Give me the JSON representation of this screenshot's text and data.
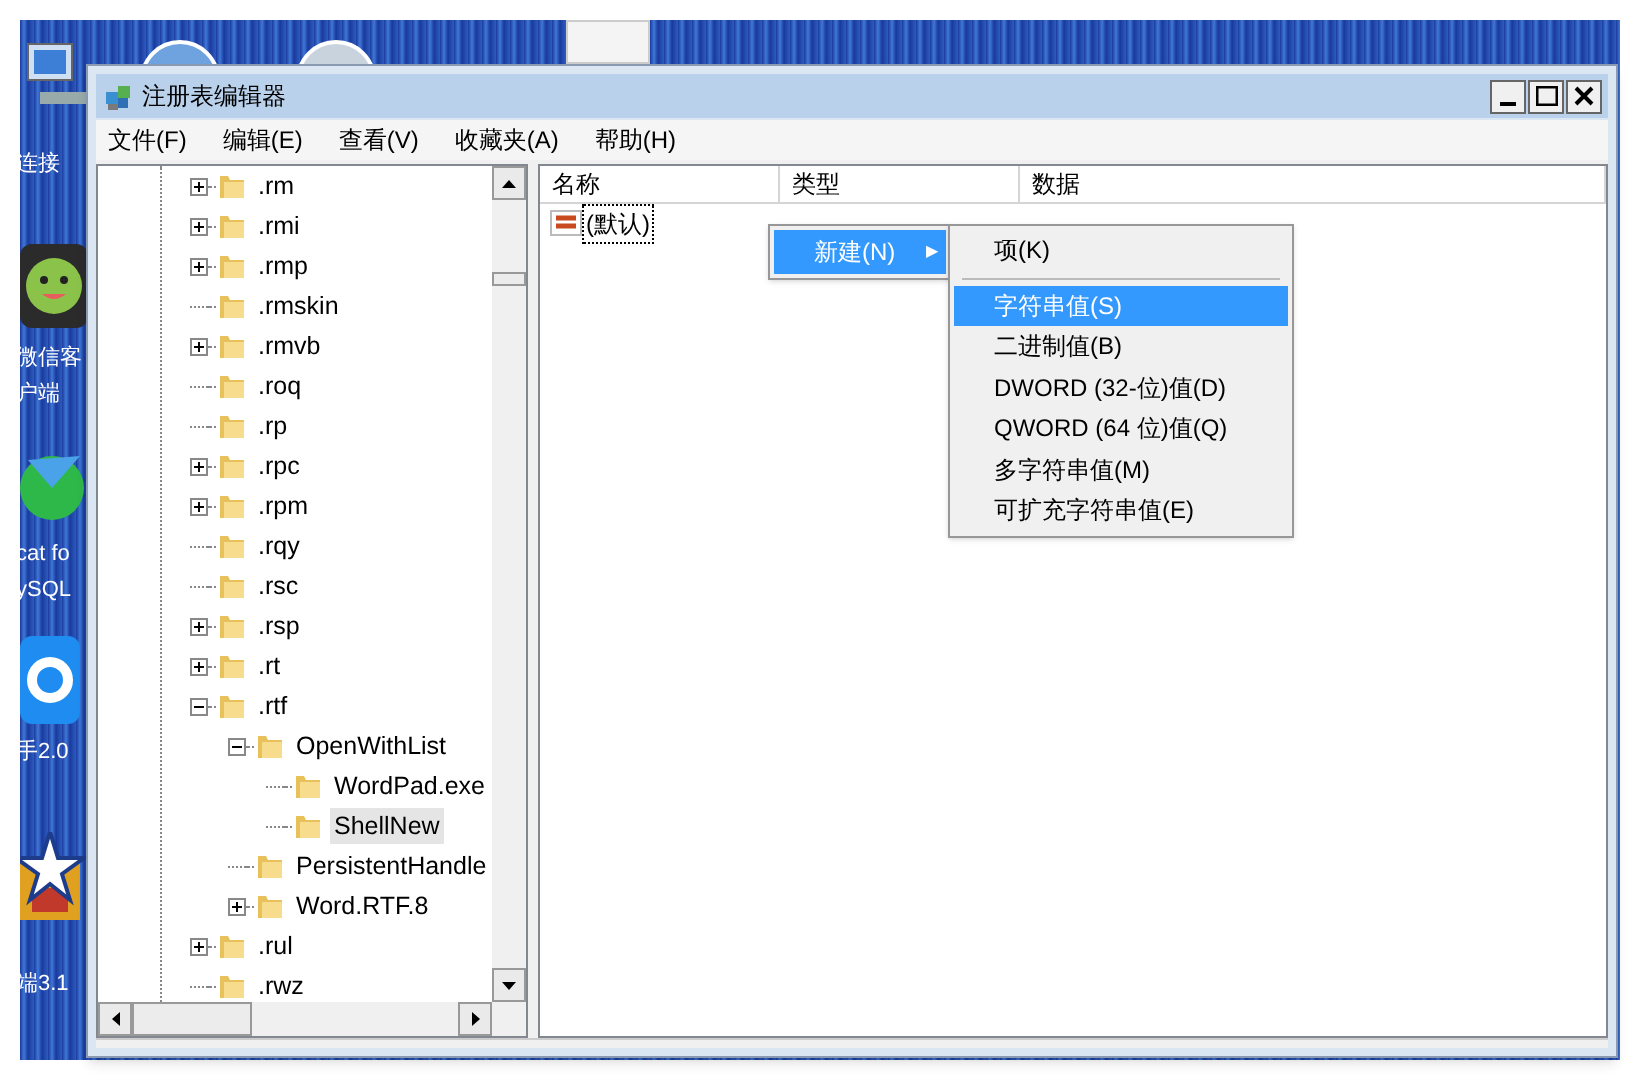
{
  "desktop": {
    "icon_labels": [
      {
        "text": "连接",
        "kind": "network"
      },
      {
        "text": "微信客",
        "kind": "face"
      },
      {
        "text": "户端",
        "kind": "none"
      },
      {
        "text": "cat fo",
        "kind": "ball"
      },
      {
        "text": "ySQL",
        "kind": "none"
      },
      {
        "text": "手2.0",
        "kind": "ring"
      },
      {
        "text": "端3.1",
        "kind": "star"
      }
    ]
  },
  "window": {
    "title": "注册表编辑器"
  },
  "menu_bar": [
    "文件(F)",
    "编辑(E)",
    "查看(V)",
    "收藏夹(A)",
    "帮助(H)"
  ],
  "tree": [
    {
      "name": ".rm",
      "kind": "collapsed",
      "selected": false
    },
    {
      "name": ".rmi",
      "kind": "collapsed",
      "selected": false
    },
    {
      "name": ".rmp",
      "kind": "collapsed",
      "selected": false
    },
    {
      "name": ".rmskin",
      "kind": "leaf",
      "selected": false
    },
    {
      "name": ".rmvb",
      "kind": "collapsed",
      "selected": false
    },
    {
      "name": ".roq",
      "kind": "leaf",
      "selected": false
    },
    {
      "name": ".rp",
      "kind": "leaf",
      "selected": false
    },
    {
      "name": ".rpc",
      "kind": "collapsed",
      "selected": false
    },
    {
      "name": ".rpm",
      "kind": "collapsed",
      "selected": false
    },
    {
      "name": ".rqy",
      "kind": "leaf",
      "selected": false
    },
    {
      "name": ".rsc",
      "kind": "leaf",
      "selected": false
    },
    {
      "name": ".rsp",
      "kind": "collapsed",
      "selected": false
    },
    {
      "name": ".rt",
      "kind": "collapsed",
      "selected": false
    },
    {
      "name": ".rtf",
      "kind": "expanded",
      "selected": false,
      "children": [
        {
          "name": "OpenWithList",
          "kind": "expanded",
          "selected": false,
          "children": [
            {
              "name": "WordPad.exe",
              "kind": "leaf",
              "selected": false
            },
            {
              "name": "ShellNew",
              "kind": "leaf",
              "selected": true
            }
          ]
        },
        {
          "name": "PersistentHandle",
          "kind": "leaf",
          "selected": false
        },
        {
          "name": "Word.RTF.8",
          "kind": "collapsed",
          "selected": false
        }
      ]
    },
    {
      "name": ".rul",
      "kind": "collapsed",
      "selected": false
    },
    {
      "name": ".rwz",
      "kind": "leaf",
      "selected": false
    }
  ],
  "list": {
    "columns": [
      "名称",
      "类型",
      "数据"
    ],
    "rows": [
      {
        "name": "(默认)",
        "focused": true
      }
    ]
  },
  "context_menu": {
    "items": [
      {
        "label": "新建(N)",
        "arrow": "▶",
        "selected": true
      }
    ]
  },
  "submenu": {
    "items": [
      {
        "kind": "item",
        "label": "项(K)",
        "selected": false
      },
      {
        "kind": "separator"
      },
      {
        "kind": "item",
        "label": "字符串值(S)",
        "selected": true
      },
      {
        "kind": "item",
        "label": "二进制值(B)",
        "selected": false
      },
      {
        "kind": "item",
        "label": "DWORD (32-位)值(D)",
        "selected": false
      },
      {
        "kind": "item",
        "label": "QWORD (64 位)值(Q)",
        "selected": false
      },
      {
        "kind": "item",
        "label": "多字符串值(M)",
        "selected": false
      },
      {
        "kind": "item",
        "label": "可扩充字符串值(E)",
        "selected": false
      }
    ]
  }
}
